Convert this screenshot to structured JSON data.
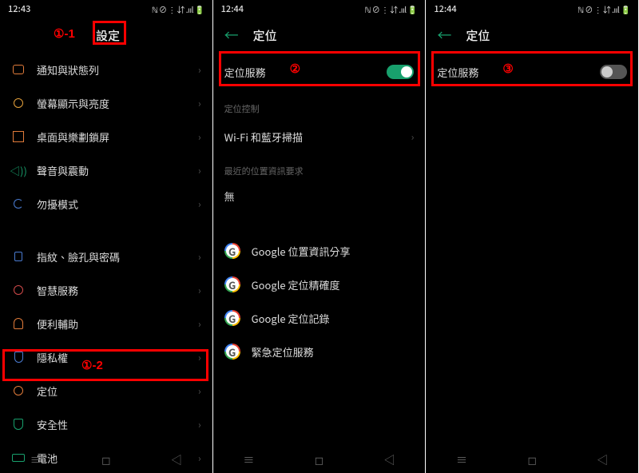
{
  "annotations": {
    "a1": "①-1",
    "a2": "①-2",
    "a3": "②",
    "a4": "③"
  },
  "panel1": {
    "status": {
      "time": "12:43",
      "right": "ℕ ⊘ ⋮ ⇵ .ııl 🔋"
    },
    "title": "設定",
    "items": [
      {
        "label": "通知與狀態列"
      },
      {
        "label": "螢幕顯示與亮度"
      },
      {
        "label": "桌面與樂劃鎖屏"
      },
      {
        "label": "聲音與震動"
      },
      {
        "label": "勿擾模式"
      }
    ],
    "items2": [
      {
        "label": "指紋、臉孔與密碼"
      },
      {
        "label": "智慧服務"
      },
      {
        "label": "便利輔助"
      },
      {
        "label": "隱私權"
      },
      {
        "label": "定位"
      },
      {
        "label": "安全性"
      },
      {
        "label": "電池"
      }
    ]
  },
  "panel2": {
    "status": {
      "time": "12:44",
      "right": "ℕ ⊘ ⋮ ⇵ .ııl 🔋"
    },
    "title": "定位",
    "locService": "定位服務",
    "section_control": "定位控制",
    "row_wifi": "Wi-Fi 和藍牙掃描",
    "section_recent": "最近的位置資訊要求",
    "recent_value": "無",
    "gitems": [
      {
        "label": "Google 位置資訊分享"
      },
      {
        "label": "Google 定位精確度"
      },
      {
        "label": "Google 定位記錄"
      },
      {
        "label": "緊急定位服務"
      }
    ]
  },
  "panel3": {
    "status": {
      "time": "12:44",
      "right": "ℕ ⊘ ⋮ ⇵ .ııl 🔋"
    },
    "title": "定位",
    "locService": "定位服務"
  }
}
